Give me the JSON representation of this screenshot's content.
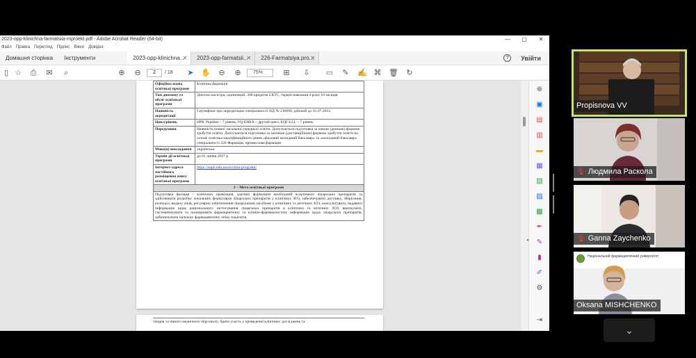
{
  "window": {
    "title": "2023-opp-klinichna-farmatsiia-mproekt.pdf - Adobe Acrobat Reader (64-bit)",
    "controls": [
      "—",
      "▢",
      "✕"
    ]
  },
  "menu": [
    "Файл",
    "Правка",
    "Перегляд",
    "Підпис",
    "Вікно",
    "Довідка"
  ],
  "tabs": {
    "home": "Домашня сторінка",
    "tools": "Інструменти",
    "docs": [
      "2023-opp-klinichna...",
      "2023-opp-farmatsii...",
      "226-Farmatsiya.pro..."
    ],
    "login": "Увійти"
  },
  "toolbar": {
    "page_current": "2",
    "page_total": "/ 18",
    "zoom": "75%"
  },
  "document": {
    "rows": [
      {
        "key": "Офіційна назва освітньої програми",
        "value": "Клінічна фармація"
      },
      {
        "key": "Тип диплому та обсяг освітньої програми",
        "value": "Диплом магістра, одиничний, 300 кредитів ЄКТС, термін навчання 4 роки 10 місяців"
      },
      {
        "key": "Наявність акредитації",
        "value": "Сертифікат про акредитацію спеціальності НД № 210690, дійсний до 01.07.2024"
      },
      {
        "key": "Цикл/рівень",
        "value": "НРК України – 7 рівень, FQ-EHEA – другий цикл, EQF-LLL – 7 рівень"
      },
      {
        "key": "Передумови",
        "value": "Наявність повної загальної середньої освіти. Допускається підготовка за очною (денною) формою здобуття освіти. Допускається підготовка за заочною (дистанційною) формою здобуття освіти на основі освітньо-кваліфікаційного рівня «фаховий молодший бакалавр» та «молодший бакалавр» спеціальності 226 Фармація, промислова фармація"
      },
      {
        "key": "Мова(и) викладання",
        "value": "українська"
      },
      {
        "key": "Термін дії освітньої програми",
        "value": "до 01 липня 2027 р"
      },
      {
        "key": "Інтернет-адреса постійного розміщення опису освітньої програми",
        "value": "https://nuph.edu.ua/osvitnia-programi/"
      }
    ],
    "section_title": "2 – Мета освітньої програми",
    "purpose": "Підготовка фахівця – клінічних провізорів, здатних формувати необхідний асортимент лікарських препаратів та здійснювати розробку локальних формулярів лікарських препаратів у клінічних ЗОЗ, забезпечувати доставку, зберігання, розподіл, видачу ліків, регулярно забезпечення лікарськими засобами у клінічних та аптечних ЗОЗ, консультувати, надавати інформацію щодо раціонального застосування лікарських препаратів в клінічних та аптечних ЗОЗ, виконувати, систематизувати та поширювати фармацевтичну та клініко-фармакологічну інформацію щодо лікарських препаратів, забезпечувати належну фармацевтичну опіку пацієнтів,",
    "page2_text": "лікарів та іншого медичного персоналу; брати участь у проведенні клінічних досліджень та"
  },
  "participants": [
    {
      "name": "Propisnova VV",
      "muted": false
    },
    {
      "name": "Людмила Раскола",
      "muted": true
    },
    {
      "name": "Ganna Zaychenko",
      "muted": true
    },
    {
      "name": "Oksana MISHCHENKO",
      "muted": false
    }
  ],
  "participant4_org": "Національний фармацевтичний університет",
  "colors": {
    "active_speaker": "#c8e36a",
    "mic_off": "#ff3b30"
  }
}
